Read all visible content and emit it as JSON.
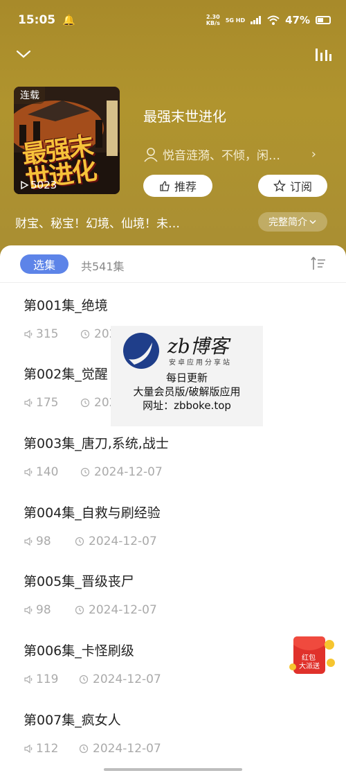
{
  "status_bar": {
    "time": "15:05",
    "speed_value": "2.30",
    "speed_unit": "KB/s",
    "network": "5G HD",
    "battery": "47%"
  },
  "book": {
    "cover_tag": "连载",
    "cover_plays": "5023",
    "cover_art_text": "最强末世进化",
    "title": "最强末世进化",
    "authors": "悦音涟漪、不倾，闲…",
    "recommend_label": "推荐",
    "subscribe_label": "订阅",
    "description": "财宝、秘宝！幻境、仙境！未…",
    "full_intro_label": "完整简介"
  },
  "panel": {
    "tab_label": "选集",
    "total_label": "共541集"
  },
  "episodes": [
    {
      "title": "第001集_绝境",
      "plays": "315",
      "date": "2024-12-07"
    },
    {
      "title": "第002集_觉醒",
      "plays": "175",
      "date": "2024-12-07"
    },
    {
      "title": "第003集_唐刀,系统,战士",
      "plays": "140",
      "date": "2024-12-07"
    },
    {
      "title": "第004集_自救与刷经验",
      "plays": "98",
      "date": "2024-12-07"
    },
    {
      "title": "第005集_晋级丧尸",
      "plays": "98",
      "date": "2024-12-07"
    },
    {
      "title": "第006集_卡怪刷级",
      "plays": "119",
      "date": "2024-12-07"
    },
    {
      "title": "第007集_疯女人",
      "plays": "112",
      "date": "2024-12-07"
    }
  ],
  "watermark": {
    "brand": "zb博客",
    "subtitle": "安卓应用分享站",
    "line1": "每日更新",
    "line2": "大量会员版/破解版应用",
    "line3": "网址：zbboke.top"
  },
  "promo": {
    "label_top": "红包",
    "label_bottom": "大派送"
  },
  "colors": {
    "header_bg": "#ab8f30",
    "accent_blue": "#5d84e8",
    "meta_gray": "#aaaaaa"
  }
}
